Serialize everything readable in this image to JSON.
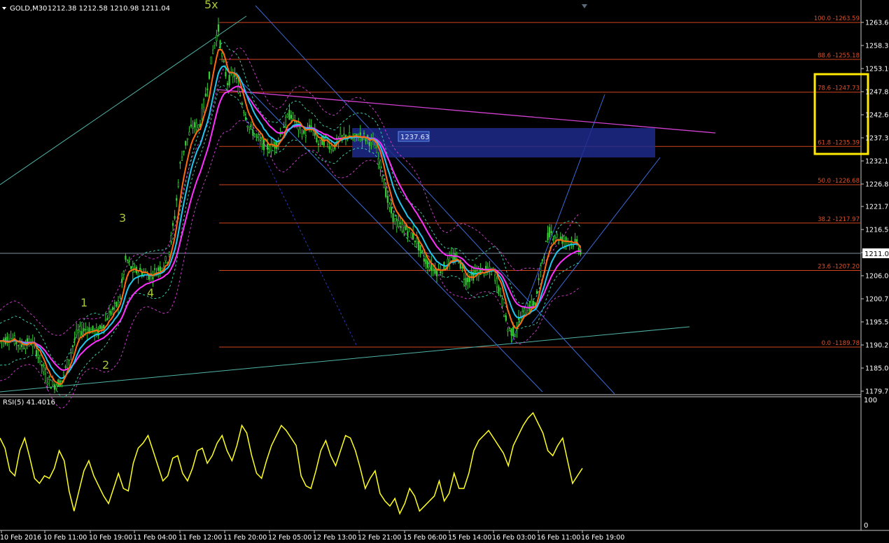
{
  "header": {
    "symbol_label": "GOLD,M30",
    "ohlc": "1212.38 1212.58 1210.98 1211.04"
  },
  "chart_data": [
    {
      "type": "candlestick",
      "title": "GOLD,M30",
      "ohlc_last": {
        "open": 1212.38,
        "high": 1212.58,
        "low": 1210.98,
        "close": 1211.04
      },
      "ylim": [
        1178.5,
        1266.5
      ],
      "y_ticks": [
        "1263.60",
        "1258.35",
        "1253.10",
        "1247.85",
        "1242.60",
        "1237.35",
        "1232.10",
        "1226.85",
        "1221.75",
        "1216.50",
        "1211.25",
        "1206.00",
        "1200.75",
        "1195.50",
        "1190.25",
        "1185.00",
        "1179.75"
      ],
      "x_ticks": [
        "10 Feb 2016",
        "10 Feb 11:00",
        "10 Feb 19:00",
        "11 Feb 04:00",
        "11 Feb 12:00",
        "11 Feb 20:00",
        "12 Feb 05:00",
        "12 Feb 13:00",
        "12 Feb 21:00",
        "15 Feb 06:00",
        "15 Feb 14:00",
        "16 Feb 03:00",
        "16 Feb 11:00",
        "16 Feb 19:00"
      ],
      "current_price": "1211.04",
      "box_price_label": "1237.63",
      "fibonacci_levels": [
        {
          "label": "100.0 -1263.59",
          "price": 1263.59
        },
        {
          "label": "88.6 -1255.18",
          "price": 1255.18
        },
        {
          "label": "78.6 -1247.73",
          "price": 1247.73
        },
        {
          "label": "61.8 -1235.39",
          "price": 1235.39
        },
        {
          "label": "50.0 -1226.68",
          "price": 1226.68
        },
        {
          "label": "38.2 -1217.97",
          "price": 1217.97
        },
        {
          "label": "23.6 -1207.20",
          "price": 1207.2
        },
        {
          "label": "0.0 -1189.78",
          "price": 1189.78
        }
      ],
      "wave_labels": [
        "1",
        "2",
        "3",
        "4",
        "5x"
      ],
      "path_points": [
        [
          0,
          1191
        ],
        [
          15,
          1192
        ],
        [
          30,
          1190
        ],
        [
          45,
          1191
        ],
        [
          55,
          1188
        ],
        [
          65,
          1183
        ],
        [
          75,
          1181
        ],
        [
          88,
          1182
        ],
        [
          100,
          1188
        ],
        [
          110,
          1193
        ],
        [
          125,
          1194
        ],
        [
          140,
          1193
        ],
        [
          155,
          1197
        ],
        [
          170,
          1200
        ],
        [
          180,
          1210
        ],
        [
          190,
          1207
        ],
        [
          200,
          1207
        ],
        [
          215,
          1206
        ],
        [
          230,
          1208
        ],
        [
          240,
          1210
        ],
        [
          250,
          1220
        ],
        [
          258,
          1232
        ],
        [
          265,
          1236
        ],
        [
          275,
          1240
        ],
        [
          285,
          1240
        ],
        [
          295,
          1248
        ],
        [
          305,
          1258
        ],
        [
          312,
          1262
        ],
        [
          318,
          1255
        ],
        [
          325,
          1250
        ],
        [
          335,
          1252
        ],
        [
          345,
          1246
        ],
        [
          355,
          1240
        ],
        [
          365,
          1238
        ],
        [
          375,
          1236
        ],
        [
          385,
          1235
        ],
        [
          395,
          1236
        ],
        [
          405,
          1240
        ],
        [
          415,
          1243
        ],
        [
          425,
          1240
        ],
        [
          435,
          1238
        ],
        [
          445,
          1240
        ],
        [
          455,
          1236
        ],
        [
          465,
          1237
        ],
        [
          475,
          1235
        ],
        [
          485,
          1237
        ],
        [
          495,
          1238
        ],
        [
          505,
          1237
        ],
        [
          515,
          1238
        ],
        [
          525,
          1237
        ],
        [
          535,
          1236
        ],
        [
          545,
          1230
        ],
        [
          555,
          1222
        ],
        [
          565,
          1218
        ],
        [
          575,
          1217
        ],
        [
          585,
          1216
        ],
        [
          595,
          1214
        ],
        [
          605,
          1210
        ],
        [
          615,
          1208
        ],
        [
          625,
          1207
        ],
        [
          635,
          1208
        ],
        [
          645,
          1210
        ],
        [
          655,
          1210
        ],
        [
          665,
          1205
        ],
        [
          675,
          1206
        ],
        [
          685,
          1207
        ],
        [
          695,
          1207
        ],
        [
          705,
          1207
        ],
        [
          715,
          1202
        ],
        [
          725,
          1194
        ],
        [
          735,
          1193
        ],
        [
          745,
          1197
        ],
        [
          755,
          1199
        ],
        [
          765,
          1200
        ],
        [
          775,
          1210
        ],
        [
          785,
          1216
        ],
        [
          795,
          1215
        ],
        [
          805,
          1214
        ],
        [
          815,
          1214
        ],
        [
          825,
          1213
        ],
        [
          832,
          1211
        ]
      ],
      "rsi": {
        "label": "RSI(5) 41.4016",
        "ylim": [
          0,
          100
        ],
        "y_ticks": [
          "100",
          "0"
        ],
        "values": [
          70,
          62,
          44,
          40,
          60,
          70,
          55,
          38,
          34,
          40,
          38,
          46,
          60,
          52,
          28,
          12,
          28,
          44,
          52,
          40,
          32,
          24,
          18,
          30,
          42,
          30,
          28,
          50,
          62,
          66,
          72,
          60,
          48,
          36,
          40,
          54,
          56,
          42,
          36,
          46,
          60,
          62,
          50,
          56,
          66,
          72,
          60,
          52,
          64,
          80,
          74,
          56,
          42,
          38,
          52,
          64,
          72,
          80,
          76,
          70,
          64,
          40,
          32,
          30,
          44,
          60,
          68,
          56,
          48,
          60,
          72,
          70,
          60,
          46,
          30,
          38,
          44,
          26,
          20,
          16,
          22,
          10,
          18,
          30,
          24,
          12,
          16,
          20,
          24,
          36,
          20,
          26,
          42,
          30,
          30,
          42,
          60,
          68,
          72,
          76,
          70,
          64,
          58,
          48,
          64,
          72,
          80,
          86,
          90,
          82,
          74,
          60,
          56,
          64,
          70,
          52,
          34,
          40,
          46
        ]
      }
    }
  ]
}
